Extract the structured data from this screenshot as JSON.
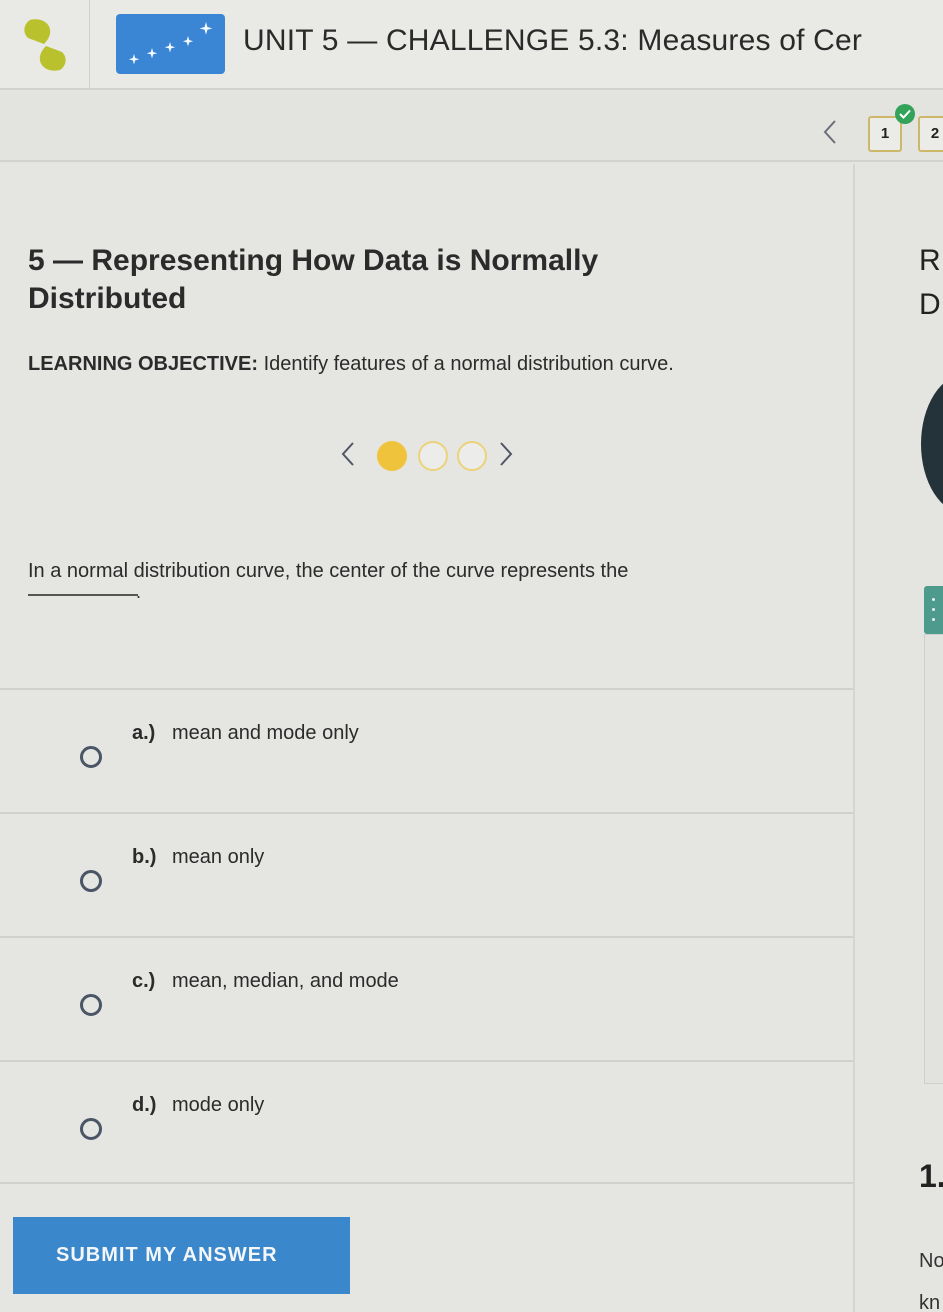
{
  "header": {
    "title": "UNIT 5 — CHALLENGE 5.3: Measures of Cer",
    "logo_icon": "brand-logo-icon",
    "unit_thumbnail_icon": "sparkles-icon"
  },
  "question_nav": {
    "prev_icon": "chevron-left-icon",
    "questions": [
      {
        "label": "1",
        "completed": true
      },
      {
        "label": "2",
        "completed": false
      }
    ],
    "completed_color": "#34a35a"
  },
  "lesson": {
    "title": "5 — Representing How Data is Normally Distributed",
    "objective_label": "LEARNING OBJECTIVE:",
    "objective_text": " Identify features of a normal distribution curve."
  },
  "stepper": {
    "prev_icon": "chevron-left-icon",
    "next_icon": "chevron-right-icon",
    "total_steps": 3,
    "current_step": 1,
    "accent_color": "#f0c33c"
  },
  "question": {
    "text": "In a normal distribution curve, the center of the curve represents the",
    "blank_suffix": "."
  },
  "answers": [
    {
      "letter": "a.)",
      "text": "mean and mode only",
      "selected": false
    },
    {
      "letter": "b.)",
      "text": "mean only",
      "selected": false
    },
    {
      "letter": "c.)",
      "text": "mean, median, and mode",
      "selected": false
    },
    {
      "letter": "d.)",
      "text": "mode only",
      "selected": false
    }
  ],
  "submit": {
    "label": "SUBMIT MY ANSWER",
    "color": "#3a87cc"
  },
  "right_panel": {
    "heading_line1": "R",
    "heading_line2": "D",
    "menu_icon": "vertical-dots-icon",
    "number": "1.",
    "text_line1": "No",
    "text_line2": "kn"
  }
}
